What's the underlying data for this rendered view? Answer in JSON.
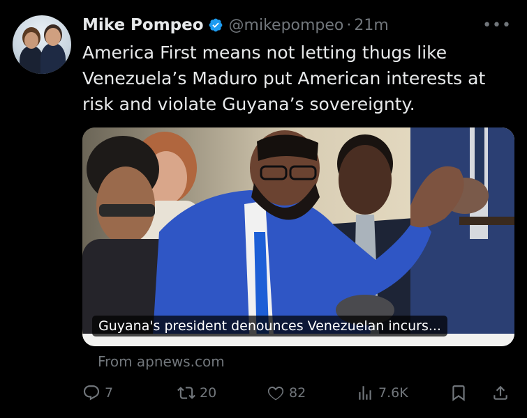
{
  "tweet": {
    "author_name": "Mike Pompeo",
    "handle": "@mikepompeo",
    "separator": "·",
    "time": "21m",
    "more_label": "•••",
    "text": "America First means not letting thugs like Venezuela’s Maduro put American interests at risk and violate Guyana’s sovereignty.",
    "verified_icon": "verified-badge-icon",
    "accent_color": "#1d9bf0"
  },
  "card": {
    "caption": "Guyana's president denounces Venezuelan incurs...",
    "source": "From apnews.com"
  },
  "actions": {
    "replies": "7",
    "reposts": "20",
    "likes": "82",
    "views": "7.6K"
  }
}
